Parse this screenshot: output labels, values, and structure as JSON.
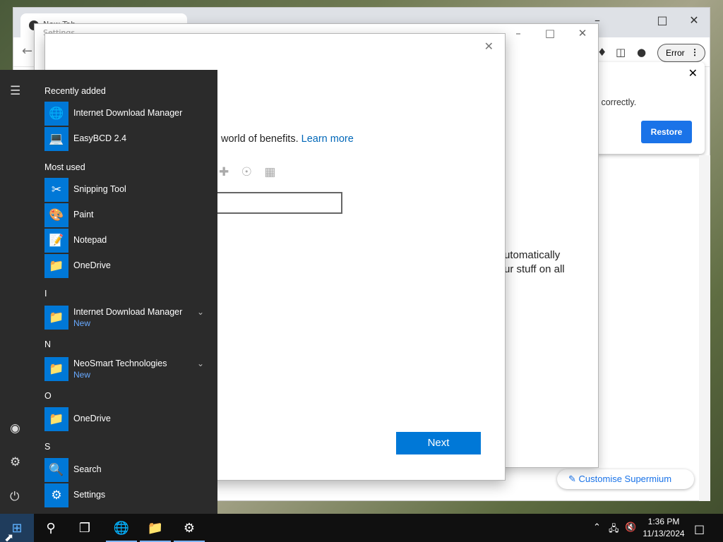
{
  "browser": {
    "tab_title": "New Tab",
    "tab_subtitle": "Settings",
    "error_label": "Error",
    "restore_popup": {
      "message": "wn correctly.",
      "button": "Restore"
    },
    "customise_label": "Customise Supermium"
  },
  "settings_window": {
    "body_line1": "utomatically",
    "body_line2": "ur stuff on all"
  },
  "dialog": {
    "benefits_text": "world of benefits.",
    "learn_more": "Learn more",
    "email_value": "",
    "next_label": "Next"
  },
  "start_menu": {
    "recently_added_label": "Recently added",
    "recently_added": [
      {
        "name": "Internet Download Manager",
        "icon": "idm-globe-icon"
      },
      {
        "name": "EasyBCD 2.4",
        "icon": "easybcd-icon"
      }
    ],
    "most_used_label": "Most used",
    "most_used": [
      {
        "name": "Snipping Tool",
        "icon": "scissors-icon"
      },
      {
        "name": "Paint",
        "icon": "palette-icon"
      },
      {
        "name": "Notepad",
        "icon": "notepad-icon"
      },
      {
        "name": "OneDrive",
        "icon": "onedrive-folder-icon"
      }
    ],
    "letters": {
      "i": "I",
      "n": "N",
      "o": "O",
      "s": "S"
    },
    "idm_folder": {
      "name": "Internet Download Manager",
      "badge": "New"
    },
    "neosmart_folder": {
      "name": "NeoSmart Technologies",
      "badge": "New"
    },
    "onedrive_item": "OneDrive",
    "search_item": "Search",
    "settings_item": "Settings"
  },
  "taskbar": {
    "time": "1:36 PM",
    "date": "11/13/2024"
  }
}
